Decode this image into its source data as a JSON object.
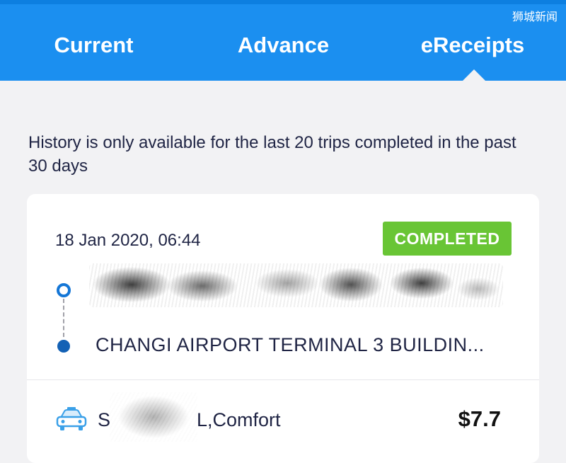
{
  "watermark": "狮城新闻",
  "tabs": [
    {
      "label": "Current"
    },
    {
      "label": "Advance"
    },
    {
      "label": "eReceipts",
      "selected": true
    }
  ],
  "notice": "History is only available for the last 20 trips completed in the past 30 days",
  "trip": {
    "datetime": "18 Jan 2020, 06:44",
    "status": "COMPLETED",
    "pickup": "",
    "dropoff": "CHANGI AIRPORT TERMINAL 3 BUILDIN...",
    "vehicle_prefix": "S",
    "vehicle_suffix": "L,Comfort",
    "fare": "$7.7"
  },
  "colors": {
    "header": "#1b8ff0",
    "status_badge": "#69c535",
    "route_dot": "#1476d6"
  },
  "icons": {
    "vehicle": "taxi-icon",
    "pickup": "pickup-dot-icon",
    "dropoff": "dropoff-dot-icon"
  }
}
